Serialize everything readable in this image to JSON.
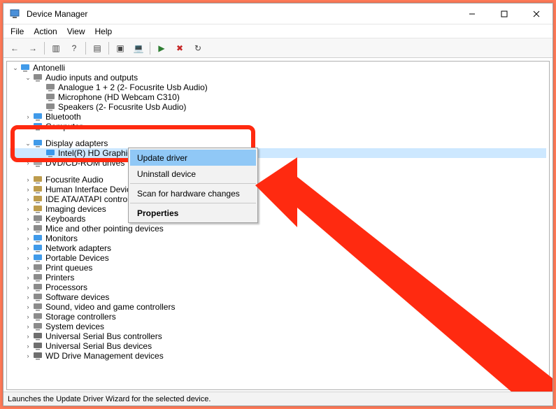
{
  "window": {
    "title": "Device Manager"
  },
  "menubar": {
    "items": [
      "File",
      "Action",
      "View",
      "Help"
    ]
  },
  "toolbar": {
    "buttons": [
      {
        "name": "back-icon",
        "glyph": "←"
      },
      {
        "name": "forward-icon",
        "glyph": "→"
      },
      {
        "name": "sep"
      },
      {
        "name": "show-hide-console-tree-icon",
        "glyph": "▥"
      },
      {
        "name": "help-icon",
        "glyph": "?"
      },
      {
        "name": "sep"
      },
      {
        "name": "properties-icon",
        "glyph": "▤"
      },
      {
        "name": "sep"
      },
      {
        "name": "update-driver-icon",
        "glyph": "▣"
      },
      {
        "name": "scan-hardware-icon",
        "glyph": "💻"
      },
      {
        "name": "sep"
      },
      {
        "name": "enable-icon",
        "glyph": "▶"
      },
      {
        "name": "uninstall-icon",
        "glyph": "✖"
      },
      {
        "name": "add-legacy-icon",
        "glyph": "↻"
      }
    ]
  },
  "tree": {
    "root": "Antonelli",
    "nodes": [
      {
        "label": "Audio inputs and outputs",
        "expanded": true,
        "icon": "audio-icon",
        "children": [
          {
            "label": "Analogue 1 + 2 (2- Focusrite Usb Audio)",
            "icon": "speaker-icon"
          },
          {
            "label": "Microphone (HD Webcam C310)",
            "icon": "mic-icon"
          },
          {
            "label": "Speakers (2- Focusrite Usb Audio)",
            "icon": "speaker-icon"
          }
        ]
      },
      {
        "label": "Bluetooth",
        "collapsed": true,
        "icon": "bluetooth-icon"
      },
      {
        "label": "Computer",
        "collapsed": true,
        "icon": "computer-icon"
      },
      {
        "label": "",
        "collapsed": false,
        "spacer": true
      },
      {
        "label": "Display adapters",
        "expanded": true,
        "icon": "display-icon",
        "children": [
          {
            "label": "Intel(R) HD Graphics 4600",
            "icon": "display-icon",
            "selected": true
          }
        ]
      },
      {
        "label": "DVD/CD-ROM drives",
        "collapsed": true,
        "icon": "dvd-icon"
      },
      {
        "label": "",
        "collapsed": false,
        "spacer": true
      },
      {
        "label": "Focusrite Audio",
        "collapsed": true,
        "icon": "focusrite-icon"
      },
      {
        "label": "Human Interface Devices",
        "collapsed": true,
        "icon": "hid-icon"
      },
      {
        "label": "IDE ATA/ATAPI controllers",
        "collapsed": true,
        "icon": "ide-icon"
      },
      {
        "label": "Imaging devices",
        "collapsed": true,
        "icon": "imaging-icon"
      },
      {
        "label": "Keyboards",
        "collapsed": true,
        "icon": "keyboard-icon"
      },
      {
        "label": "Mice and other pointing devices",
        "collapsed": true,
        "icon": "mouse-icon"
      },
      {
        "label": "Monitors",
        "collapsed": true,
        "icon": "monitor-icon"
      },
      {
        "label": "Network adapters",
        "collapsed": true,
        "icon": "network-icon"
      },
      {
        "label": "Portable Devices",
        "collapsed": true,
        "icon": "portable-icon"
      },
      {
        "label": "Print queues",
        "collapsed": true,
        "icon": "printqueue-icon"
      },
      {
        "label": "Printers",
        "collapsed": true,
        "icon": "printer-icon"
      },
      {
        "label": "Processors",
        "collapsed": true,
        "icon": "processor-icon"
      },
      {
        "label": "Software devices",
        "collapsed": true,
        "icon": "software-icon"
      },
      {
        "label": "Sound, video and game controllers",
        "collapsed": true,
        "icon": "sound-icon"
      },
      {
        "label": "Storage controllers",
        "collapsed": true,
        "icon": "storage-icon"
      },
      {
        "label": "System devices",
        "collapsed": true,
        "icon": "system-icon"
      },
      {
        "label": "Universal Serial Bus controllers",
        "collapsed": true,
        "icon": "usb-icon"
      },
      {
        "label": "Universal Serial Bus devices",
        "collapsed": true,
        "icon": "usb-icon"
      },
      {
        "label": "WD Drive Management devices",
        "collapsed": true,
        "icon": "wd-icon"
      }
    ]
  },
  "context_menu": {
    "items": [
      {
        "label": "Update driver",
        "hover": true
      },
      {
        "label": "Uninstall device"
      },
      {
        "sep": true
      },
      {
        "label": "Scan for hardware changes"
      },
      {
        "sep": true
      },
      {
        "label": "Properties",
        "bold": true
      }
    ]
  },
  "status": {
    "text": "Launches the Update Driver Wizard for the selected device."
  },
  "colors": {
    "highlight": "#ff2a10",
    "selection": "#cde8ff",
    "menu_hover": "#90c8f6"
  }
}
